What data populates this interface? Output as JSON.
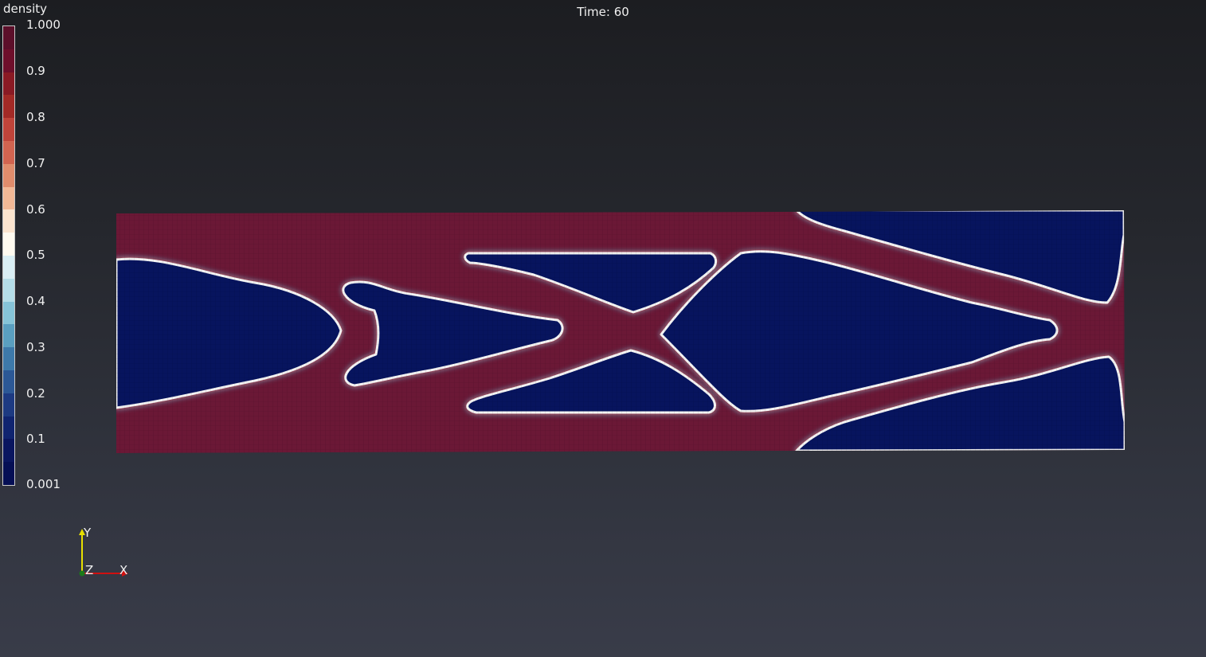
{
  "viewer": {
    "time_label": "Time: 60",
    "field_name": "density"
  },
  "colorbar": {
    "ticks": [
      "1.000",
      "0.9",
      "0.8",
      "0.7",
      "0.6",
      "0.5",
      "0.4",
      "0.3",
      "0.2",
      "0.1",
      "0.001"
    ],
    "colors_top_to_bottom": [
      "#5c0f2a",
      "#6e0f2b",
      "#8a1a24",
      "#a32a26",
      "#c0443a",
      "#d26450",
      "#e08c6c",
      "#f2b896",
      "#fbe4cf",
      "#fffaf0",
      "#d9eef4",
      "#b4dde8",
      "#86c4d8",
      "#5a9fc0",
      "#3d79aa",
      "#2c5896",
      "#1d3a82",
      "#102470",
      "#0a1660",
      "#050f55"
    ]
  },
  "mesh": {
    "solid_color": "#6b1836",
    "void_color": "#07145e",
    "edge_colors": [
      "#cc1a22",
      "#f4f4f4",
      "#5aa9c6"
    ]
  },
  "axes": {
    "y_label": "Y",
    "z_label": "Z",
    "x_label": "X",
    "y_color": "#e8e000",
    "x_color": "#d01010",
    "z_color": "#1a7a1a"
  }
}
